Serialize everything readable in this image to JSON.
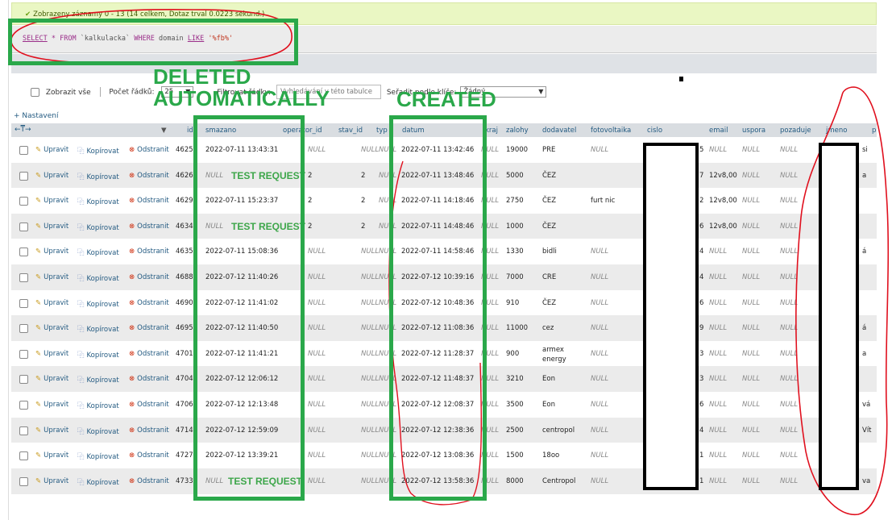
{
  "success_message": "Zobrazeny záznamy 0 - 13 (14 celkem, Dotaz trval 0.0223 sekund.)",
  "sql": {
    "select": "SELECT",
    "star": "*",
    "from": "FROM",
    "table": "`kalkulacka`",
    "where": "WHERE",
    "field": "domain",
    "like": "LIKE",
    "pattern": "'%fb%'"
  },
  "controls": {
    "show_all_label": "Zobrazit vše",
    "rows_label": "Počet řádků:",
    "rows_value": "25",
    "filter_label": "Filtrovat řádky:",
    "filter_placeholder": "Vyhledávání v této tabulce",
    "sort_label": "Seřadit podle klíče:",
    "sort_value": "Žádný"
  },
  "settings_link": "+ Nastavení",
  "columns": [
    "id",
    "smazano",
    "operator_id",
    "stav_id",
    "typ",
    "datum",
    "kraj",
    "zalohy",
    "dodavatel",
    "fotovoltaika",
    "cislo",
    "email",
    "uspora",
    "pozaduje",
    "jmeno",
    "p"
  ],
  "actions": {
    "edit": "Upravit",
    "copy": "Kopírovat",
    "delete": "Odstranit"
  },
  "null_text": "NULL",
  "rows": [
    {
      "id": "4625",
      "smazano": "2022-07-11 13:43:31",
      "operator_id": "NULL",
      "stav_id": "NULL",
      "typ": "NULL",
      "datum": "2022-07-11 13:42:46",
      "kraj": "NULL",
      "zalohy": "19000",
      "dodavatel": "PRE",
      "fotovoltaika": "NULL",
      "cislo_end": "5",
      "email": "NULL",
      "uspora": "NULL",
      "pozaduje": "NULL",
      "p": "si"
    },
    {
      "id": "4626",
      "smazano": "NULL",
      "operator_id": "2",
      "stav_id": "2",
      "typ": "NULL",
      "datum": "2022-07-11 13:48:46",
      "kraj": "NULL",
      "zalohy": "5000",
      "dodavatel": "ČEZ",
      "fotovoltaika": "",
      "cislo_end": "7",
      "email": "12v8,00",
      "uspora": "NULL",
      "pozaduje": "NULL",
      "p": "a"
    },
    {
      "id": "4629",
      "smazano": "2022-07-11 15:23:37",
      "operator_id": "2",
      "stav_id": "2",
      "typ": "NULL",
      "datum": "2022-07-11 14:18:46",
      "kraj": "NULL",
      "zalohy": "2750",
      "dodavatel": "ČEZ",
      "fotovoltaika": "furt nic",
      "cislo_end": "2",
      "email": "12v8,00",
      "uspora": "NULL",
      "pozaduje": "NULL",
      "p": ""
    },
    {
      "id": "4634",
      "smazano": "NULL",
      "operator_id": "2",
      "stav_id": "2",
      "typ": "NULL",
      "datum": "2022-07-11 14:48:46",
      "kraj": "NULL",
      "zalohy": "1000",
      "dodavatel": "ČEZ",
      "fotovoltaika": "",
      "cislo_end": "6",
      "email": "12v8,00",
      "uspora": "NULL",
      "pozaduje": "NULL",
      "p": ""
    },
    {
      "id": "4635",
      "smazano": "2022-07-11 15:08:36",
      "operator_id": "NULL",
      "stav_id": "NULL",
      "typ": "NULL",
      "datum": "2022-07-11 14:58:46",
      "kraj": "NULL",
      "zalohy": "1330",
      "dodavatel": "bidli",
      "fotovoltaika": "NULL",
      "cislo_end": "4",
      "email": "NULL",
      "uspora": "NULL",
      "pozaduje": "NULL",
      "p": "á"
    },
    {
      "id": "4688",
      "smazano": "2022-07-12 11:40:26",
      "operator_id": "NULL",
      "stav_id": "NULL",
      "typ": "NULL",
      "datum": "2022-07-12 10:39:16",
      "kraj": "NULL",
      "zalohy": "7000",
      "dodavatel": "CRE",
      "fotovoltaika": "NULL",
      "cislo_end": "4",
      "email": "NULL",
      "uspora": "NULL",
      "pozaduje": "NULL",
      "p": ""
    },
    {
      "id": "4690",
      "smazano": "2022-07-12 11:41:02",
      "operator_id": "NULL",
      "stav_id": "NULL",
      "typ": "NULL",
      "datum": "2022-07-12 10:48:36",
      "kraj": "NULL",
      "zalohy": "910",
      "dodavatel": "ČEZ",
      "fotovoltaika": "NULL",
      "cislo_end": "6",
      "email": "NULL",
      "uspora": "NULL",
      "pozaduje": "NULL",
      "p": ""
    },
    {
      "id": "4695",
      "smazano": "2022-07-12 11:40:50",
      "operator_id": "NULL",
      "stav_id": "NULL",
      "typ": "NULL",
      "datum": "2022-07-12 11:08:36",
      "kraj": "NULL",
      "zalohy": "11000",
      "dodavatel": "cez",
      "fotovoltaika": "NULL",
      "cislo_end": "9",
      "email": "NULL",
      "uspora": "NULL",
      "pozaduje": "NULL",
      "p": "á"
    },
    {
      "id": "4701",
      "smazano": "2022-07-12 11:41:21",
      "operator_id": "NULL",
      "stav_id": "NULL",
      "typ": "NULL",
      "datum": "2022-07-12 11:28:37",
      "kraj": "NULL",
      "zalohy": "900",
      "dodavatel": "armex\nenergy",
      "fotovoltaika": "NULL",
      "cislo_end": "3",
      "email": "NULL",
      "uspora": "NULL",
      "pozaduje": "NULL",
      "p": "a"
    },
    {
      "id": "4704",
      "smazano": "2022-07-12 12:06:12",
      "operator_id": "NULL",
      "stav_id": "NULL",
      "typ": "NULL",
      "datum": "2022-07-12 11:48:37",
      "kraj": "NULL",
      "zalohy": "3210",
      "dodavatel": "Eon",
      "fotovoltaika": "NULL",
      "cislo_end": "3",
      "email": "NULL",
      "uspora": "NULL",
      "pozaduje": "NULL",
      "p": ""
    },
    {
      "id": "4706",
      "smazano": "2022-07-12 12:13:48",
      "operator_id": "NULL",
      "stav_id": "NULL",
      "typ": "NULL",
      "datum": "2022-07-12 12:08:37",
      "kraj": "NULL",
      "zalohy": "3500",
      "dodavatel": "Eon",
      "fotovoltaika": "NULL",
      "cislo_end": "6",
      "email": "NULL",
      "uspora": "NULL",
      "pozaduje": "NULL",
      "p": "vá"
    },
    {
      "id": "4714",
      "smazano": "2022-07-12 12:59:09",
      "operator_id": "NULL",
      "stav_id": "NULL",
      "typ": "NULL",
      "datum": "2022-07-12 12:38:36",
      "kraj": "NULL",
      "zalohy": "2500",
      "dodavatel": "centropol",
      "fotovoltaika": "NULL",
      "cislo_end": "4",
      "email": "NULL",
      "uspora": "NULL",
      "pozaduje": "NULL",
      "p": "Vít"
    },
    {
      "id": "4727",
      "smazano": "2022-07-12 13:39:21",
      "operator_id": "NULL",
      "stav_id": "NULL",
      "typ": "NULL",
      "datum": "2022-07-12 13:08:36",
      "kraj": "NULL",
      "zalohy": "1500",
      "dodavatel": "18oo",
      "fotovoltaika": "NULL",
      "cislo_end": "1",
      "email": "NULL",
      "uspora": "NULL",
      "pozaduje": "NULL",
      "p": ""
    },
    {
      "id": "4733",
      "smazano": "NULL",
      "operator_id": "NULL",
      "stav_id": "NULL",
      "typ": "NULL",
      "datum": "2022-07-12 13:58:36",
      "kraj": "NULL",
      "zalohy": "8000",
      "dodavatel": "Centropol",
      "fotovoltaika": "NULL",
      "cislo_end": "1",
      "email": "NULL",
      "uspora": "NULL",
      "pozaduje": "NULL",
      "p": "va"
    }
  ],
  "annotations": {
    "deleted_label": "DELETED\nAUTOMATICALLY",
    "created_label": "CREATED",
    "test_request": "TEST REQUEST"
  },
  "colors": {
    "annotation_green": "#2aa84a",
    "annotation_red": "#e0101e",
    "link_blue": "#235a81"
  }
}
